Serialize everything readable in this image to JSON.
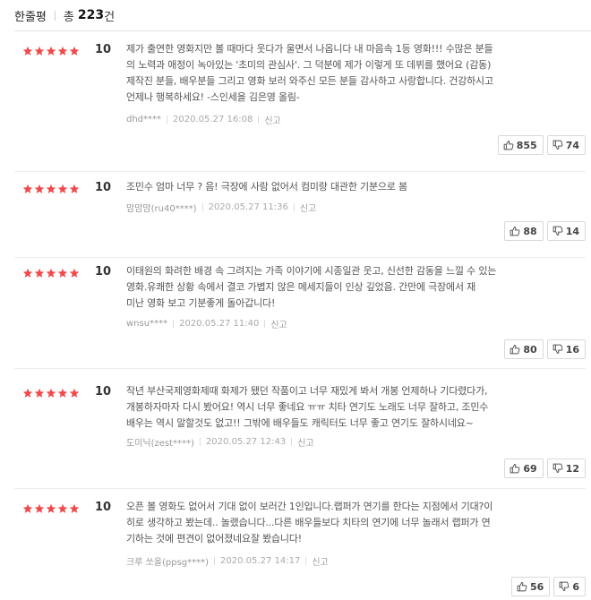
{
  "header": {
    "title": "한줄평",
    "total_label": "총",
    "total_count": "223",
    "total_unit": "건"
  },
  "reviews": [
    {
      "rating": 5,
      "score": "10",
      "lines": [
        "제가 출연한 영화지만 볼 때마다 웃다가 울면서 나옵니다 내 마음속 1등 영화!!! 수많은 분들",
        "의 노력과 애정이 녹아있는 '초미의 관심사'. 그 덕분에 제가 이렇게 또 데뷔를 했어요 (감동)",
        "제작진 분들, 배우분들 그리고 영화 보러 와주신 모든 분들 감사하고 사랑합니다. 건강하시고",
        "언제나 행복하세요! -스인세을 김은영 올림-"
      ],
      "user": "dhd****",
      "date": "2020.05.27 16:08",
      "report": "신고",
      "likes": "855",
      "dislikes": "74"
    },
    {
      "rating": 5,
      "score": "10",
      "lines": [
        "조민수 엄마 너무 ? 음! 극장에 사람 없어서 컴미랑 대관한 기분으로 봄"
      ],
      "user": "맘맘맘(ru40****)",
      "date": "2020.05.27 11:36",
      "report": "신고",
      "likes": "88",
      "dislikes": "14"
    },
    {
      "rating": 5,
      "score": "10",
      "lines": [
        "이태원의 화려한 배경 속 그려지는 가족 이야기에 시종일관 웃고, 신선한 감동을 느낄 수 있는",
        "영화.유쾌한 상황 속에서 결코 가볍지 않은 메세지들이 인상 깊었음. 간만에 극장에서 재",
        "미난 영화 보고 기분좋게 돌아갑니다!"
      ],
      "user": "wnsu****",
      "date": "2020.05.27 11:40",
      "report": "신고",
      "likes": "80",
      "dislikes": "16"
    },
    {
      "rating": 5,
      "score": "10",
      "lines": [
        "작년 부산국제영화제때 화제가 됐던 작품이고 너무 재밌게 봐서 개봉 언제하나 기다렸다가,",
        "개봉하자마자 다시 봤어요! 역시 너무 좋네요 ㅠㅠ 치타 연기도 노래도 너무 잘하고, 조민수",
        "배우는 역시 말할것도 없고!! 그밖에 배우들도 캐릭터도 너무 좋고 연기도 잘하시네요~"
      ],
      "user": "도미닉(zest****)",
      "date": "2020.05.27 12:43",
      "report": "신고",
      "likes": "69",
      "dislikes": "12"
    },
    {
      "rating": 5,
      "score": "10",
      "lines": [
        "오픈 볼 영화도 없어서 기대 없이 보러간 1인입니다.랩퍼가 연기를 한다는 지점에서 기대?이",
        "히로 생각하고 봤는데.. 놀랬습니다...다른 배우들보다 치타의 연기에 너무 놀래서 랩퍼가 연",
        "기하는 것에 편견이 없어졌네요잘 봤습니다!"
      ],
      "user": "크루 쏘올(ppsg****)",
      "date": "2020.05.27 14:17",
      "report": "신고",
      "likes": "56",
      "dislikes": "6"
    }
  ]
}
